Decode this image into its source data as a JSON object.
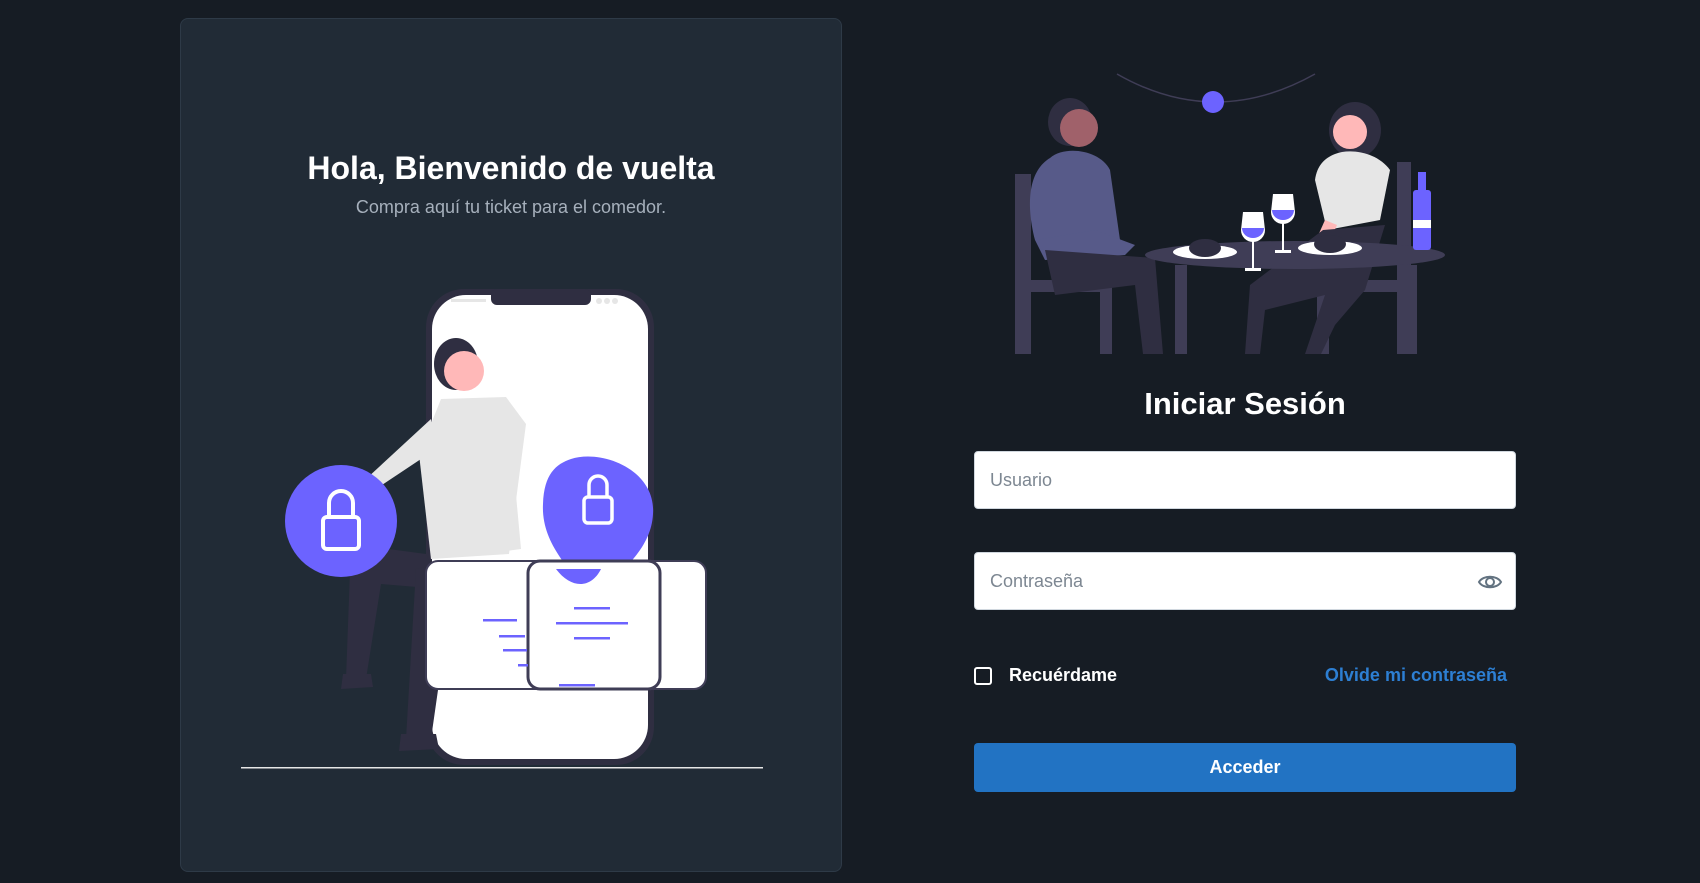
{
  "welcome": {
    "title": "Hola, Bienvenido de vuelta",
    "subtitle": "Compra aquí tu ticket para el comedor."
  },
  "login": {
    "title": "Iniciar Sesión",
    "username_placeholder": "Usuario",
    "password_placeholder": "Contraseña",
    "remember_label": "Recuérdame",
    "forgot_label": "Olvide mi contraseña",
    "submit_label": "Acceder"
  },
  "icons": {
    "password_toggle": "eye-icon",
    "left_illustration": "phone-security-illustration",
    "right_illustration": "dining-couple-illustration"
  },
  "colors": {
    "background": "#161c24",
    "card": "#212b36",
    "accent": "#6c63ff",
    "primary": "#2273c3",
    "link": "#2d7fd3"
  }
}
